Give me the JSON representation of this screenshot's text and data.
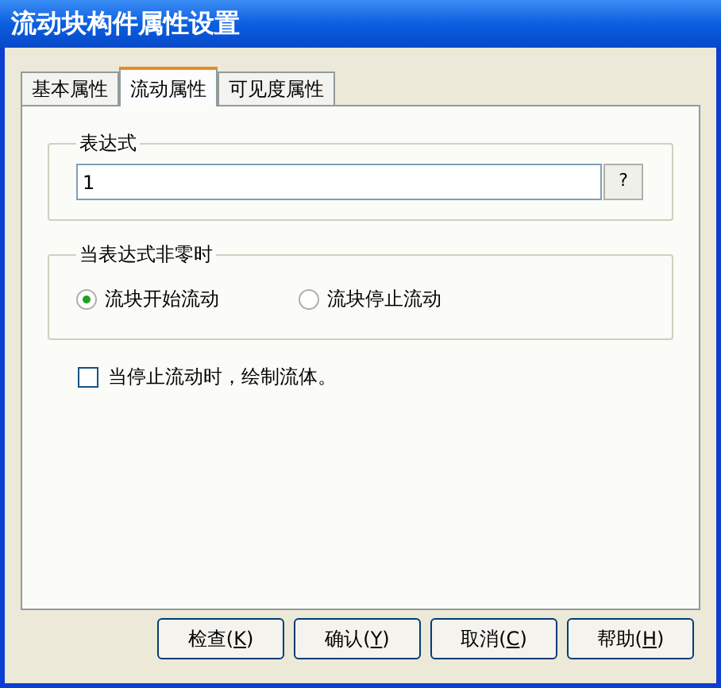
{
  "window": {
    "title": "流动块构件属性设置"
  },
  "tabs": [
    {
      "label": "基本属性",
      "selected": false
    },
    {
      "label": "流动属性",
      "selected": true
    },
    {
      "label": "可见度属性",
      "selected": false
    }
  ],
  "expression": {
    "label": "表达式",
    "value": "1",
    "help_button": "?"
  },
  "nonzero": {
    "label": "当表达式非零时",
    "options": [
      {
        "label": "流块开始流动",
        "selected": true
      },
      {
        "label": "流块停止流动",
        "selected": false
      }
    ]
  },
  "draw_fluid": {
    "label": "当停止流动时，绘制流体。",
    "checked": false
  },
  "buttons": [
    {
      "prefix": "检查(",
      "key": "K",
      "suffix": ")"
    },
    {
      "prefix": "确认(",
      "key": "Y",
      "suffix": ")"
    },
    {
      "prefix": "取消(",
      "key": "C",
      "suffix": ")"
    },
    {
      "prefix": "帮助(",
      "key": "H",
      "suffix": ")"
    }
  ]
}
